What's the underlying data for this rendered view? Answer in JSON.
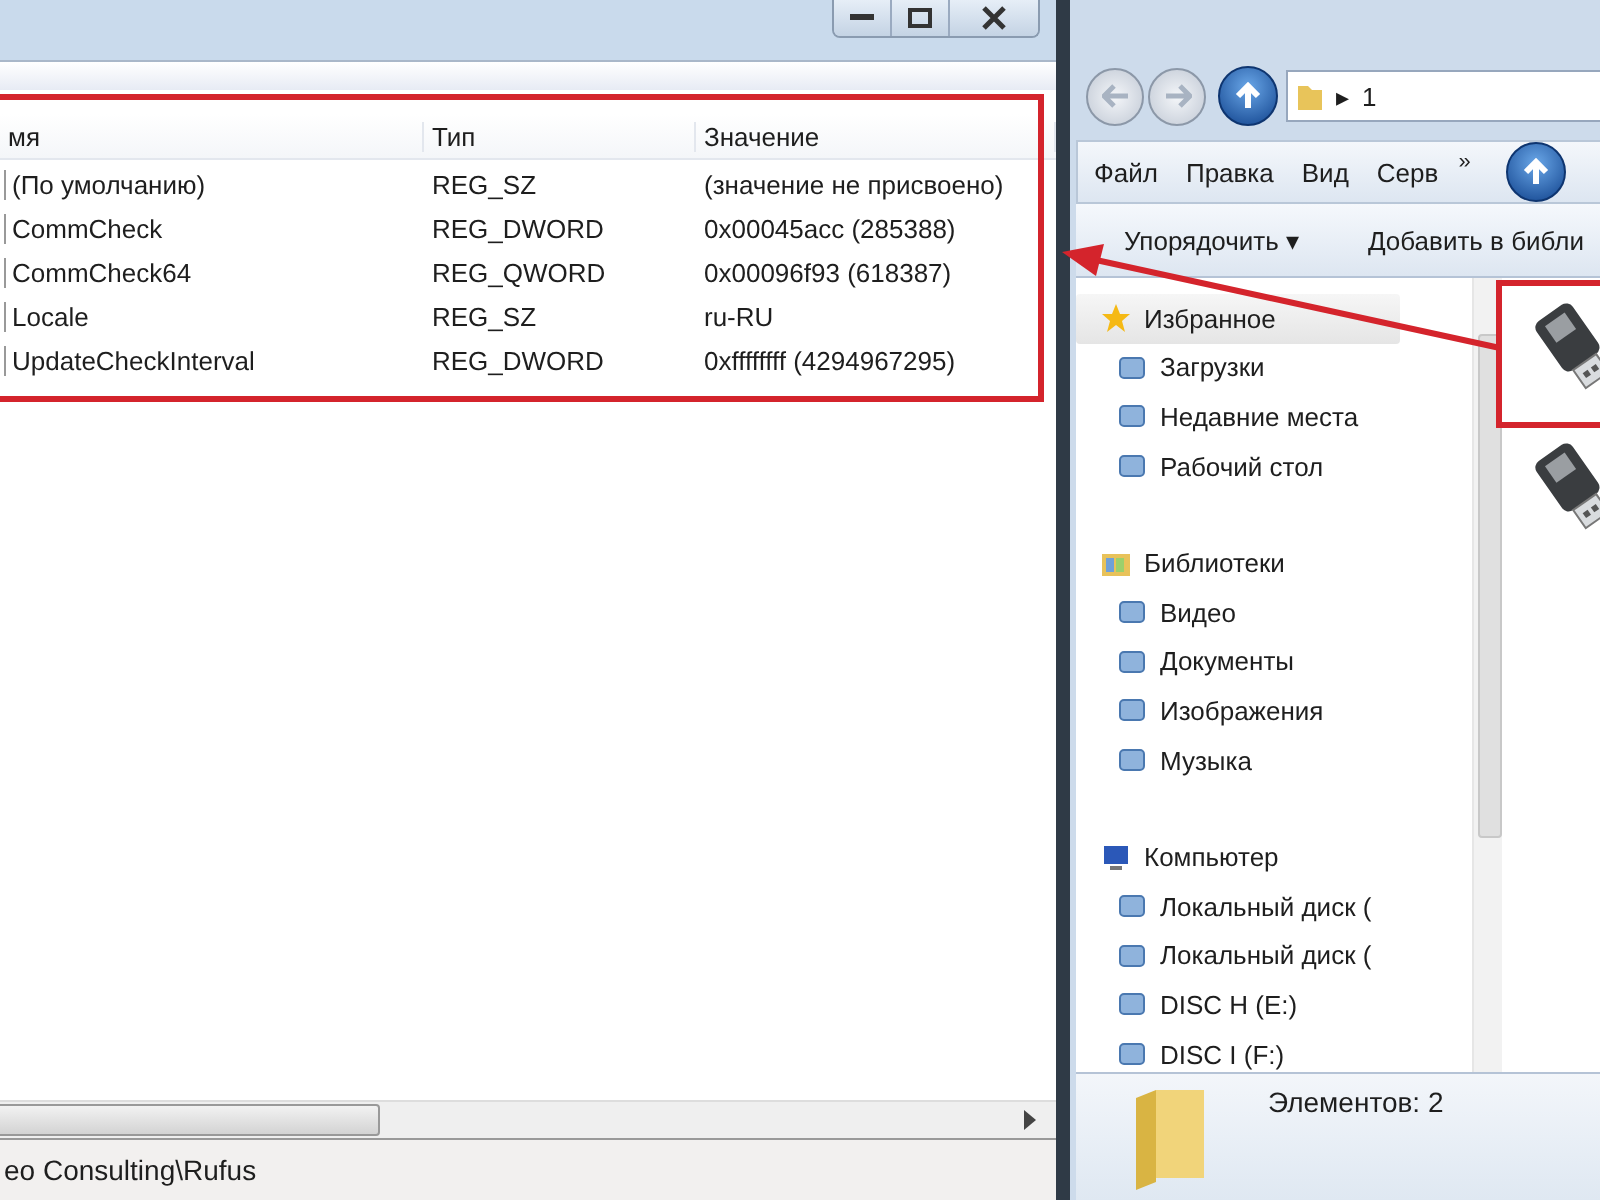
{
  "registry": {
    "columns": [
      "мя",
      "Тип",
      "Значение"
    ],
    "rows": [
      {
        "name": "(По умолчанию)",
        "type": "REG_SZ",
        "value": "(значение не присвоено)"
      },
      {
        "name": "CommCheck",
        "type": "REG_DWORD",
        "value": "0x00045acc (285388)"
      },
      {
        "name": "CommCheck64",
        "type": "REG_QWORD",
        "value": "0x00096f93 (618387)"
      },
      {
        "name": "Locale",
        "type": "REG_SZ",
        "value": "ru-RU"
      },
      {
        "name": "UpdateCheckInterval",
        "type": "REG_DWORD",
        "value": "0xffffffff (4294967295)"
      }
    ],
    "status_bar": "eo Consulting\\Rufus"
  },
  "explorer": {
    "address": {
      "separator": "▸",
      "path": "1"
    },
    "menu": [
      "Файл",
      "Правка",
      "Вид",
      "Серв"
    ],
    "menu_overflow": "»",
    "toolbar": {
      "organize": "Упорядочить",
      "organize_caret": "▾",
      "add_to_library": "Добавить в библи"
    },
    "nav_tree": [
      {
        "label": "Избранное",
        "selected": true,
        "children": [
          {
            "label": "Загрузки",
            "selected": false
          },
          {
            "label": "Недавние места",
            "selected": false
          },
          {
            "label": "Рабочий стол",
            "selected": false
          }
        ]
      },
      {
        "label": "Библиотеки",
        "selected": false,
        "children": [
          {
            "label": "Видео",
            "selected": false
          },
          {
            "label": "Документы",
            "selected": false
          },
          {
            "label": "Изображения",
            "selected": false
          },
          {
            "label": "Музыка",
            "selected": false
          }
        ]
      },
      {
        "label": "Компьютер",
        "selected": false,
        "children": [
          {
            "label": "Локальный диск (",
            "selected": false
          },
          {
            "label": "Локальный диск (",
            "selected": false
          },
          {
            "label": "DISC H (E:)",
            "selected": false
          },
          {
            "label": "DISC I (F:)",
            "selected": false
          }
        ]
      }
    ],
    "files": [
      {
        "kind": "picture"
      },
      {
        "kind": "picture"
      }
    ],
    "status": "Элементов: 2"
  }
}
